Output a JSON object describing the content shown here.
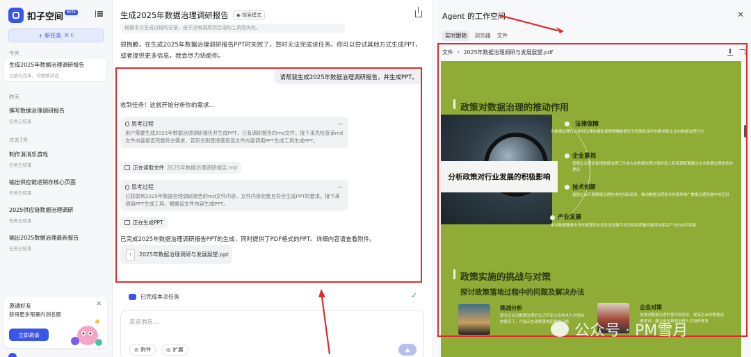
{
  "sidebar": {
    "logo_text": "扣子空间",
    "beta": "BETA",
    "new_task": "+ 新任务",
    "new_task_shortcut": "⌘ K",
    "sections": {
      "today": "今天",
      "yesterday": "昨天",
      "past7": "过去7天"
    },
    "items": [
      {
        "title": "生成2025年数据治理调研报告",
        "status": "已执行完毕，可继续对话"
      },
      {
        "title": "撰写数据治理调研报告",
        "status": "任务已结束"
      },
      {
        "title": "制作消消乐游戏",
        "status": "任务已结束"
      },
      {
        "title": "输出供应链进销存核心页面",
        "status": "任务已结束"
      },
      {
        "title": "2025供应链数据治理调研",
        "status": "任务已结束"
      },
      {
        "title": "输出2025数据治理最新报告",
        "status": "任务已结束"
      }
    ],
    "invite": {
      "line1": "邀请好友",
      "line2": "获得更多限量内测名额",
      "button": "立即邀请",
      "close": "✕"
    }
  },
  "chat": {
    "title": "生成2025年数据治理调研报告",
    "mode_badge": "探索模式",
    "faded_text": "根据本次生成过程的记录，由于没有调用到合适的工具而失败。",
    "sorry_text": "很抱歉，在生成2025年数据治理调研报告PPT时失败了，暂时无法完成该任务。你可以尝试其他方式生成PPT，或者提供更多信息，我会尽力协助你。",
    "user_message": "请帮我生成2025年数据治理调研报告，并生成PPT。",
    "received": "收到任务！这就开始分析你的需求...",
    "think1": {
      "header": "思考过程",
      "content": "用户需要生成2025年数据治理调研报告并生成PPT，已有调研报告的md文件。接下来先检查该md文件内容是否完整符合需求，若符合则直接使用该文件内容调用PPT生成工具生成PPT。"
    },
    "reading_chip": {
      "label": "正在读取文件",
      "file": "2025年数据治理调研报告.md"
    },
    "think2": {
      "header": "思考过程",
      "content": "已获取到2025年数据治理调研报告的md文件内容，文件内容完整且符合生成PPT的要求。接下来调用PPT生成工具，根据该文件内容生成PPT。"
    },
    "generating_chip": {
      "label": "正在生成PPT"
    },
    "result_text": "已完成2025年数据治理调研报告PPT的生成，同时提供了PDF格式的PPT。详细内容请查看附件。",
    "file_chip": {
      "name": "2025年数据治理调研与发展展望.ppt",
      "icon": "?"
    },
    "done_bar": "已完成本次任务",
    "input": {
      "placeholder": "发送消息...",
      "attach": "附件",
      "extend": "扩展"
    }
  },
  "workspace": {
    "title": "Agent 的工作空间",
    "close": "✕",
    "tabs": [
      "实时跟随",
      "浏览器",
      "文件"
    ],
    "pdf_path_root": "文件",
    "pdf_path_sep": "›",
    "pdf_file": "2025年数据治理调研与发展展望.pdf",
    "pdf": {
      "section1": "政策对数据治理的推动作用",
      "photo_caption": "分析政策对行业发展的积极影响",
      "points": [
        {
          "title": "法律保障",
          "desc": "为数据治理行业提供法律依据和保障明确数据安全和隐私保护的要求和企业的数据治理行为"
        },
        {
          "title": "企业重视",
          "desc": "促使企业更加重视数据治理工作加大在数据治理方面的投入和资源配置推动企业数据治理体系的建设"
        },
        {
          "title": "技术创新",
          "desc": "激励企业开展数据治理技术的创新研发，推动数据治理技术的研发推广数据治理实施中的应用"
        },
        {
          "title": "产业发展",
          "desc": "推动数据要素市场化配置和价值化促进数字经济的高质量发展带动相关产业的协同发展"
        }
      ],
      "section2": "政策实施的挑战与对策",
      "sub2": "探讨政策落地过程中的问题及解决办法",
      "challenges": [
        {
          "title": "挑战分析",
          "desc": "部分企业对数据治理的认识不足以及技术人才短缺的情况下，可能存在政策落地困难的问题"
        },
        {
          "title": "企业对策",
          "desc": "加强对数据治理的宣传和培训，提高企业的数据治理意识，建立健全数据治理人才培养体系"
        }
      ]
    }
  },
  "watermark": "公众号 · PM雪月",
  "colors": {
    "accent": "#3b55e6",
    "annotation_red": "#e02b2b",
    "pdf_green": "#8fac37"
  }
}
